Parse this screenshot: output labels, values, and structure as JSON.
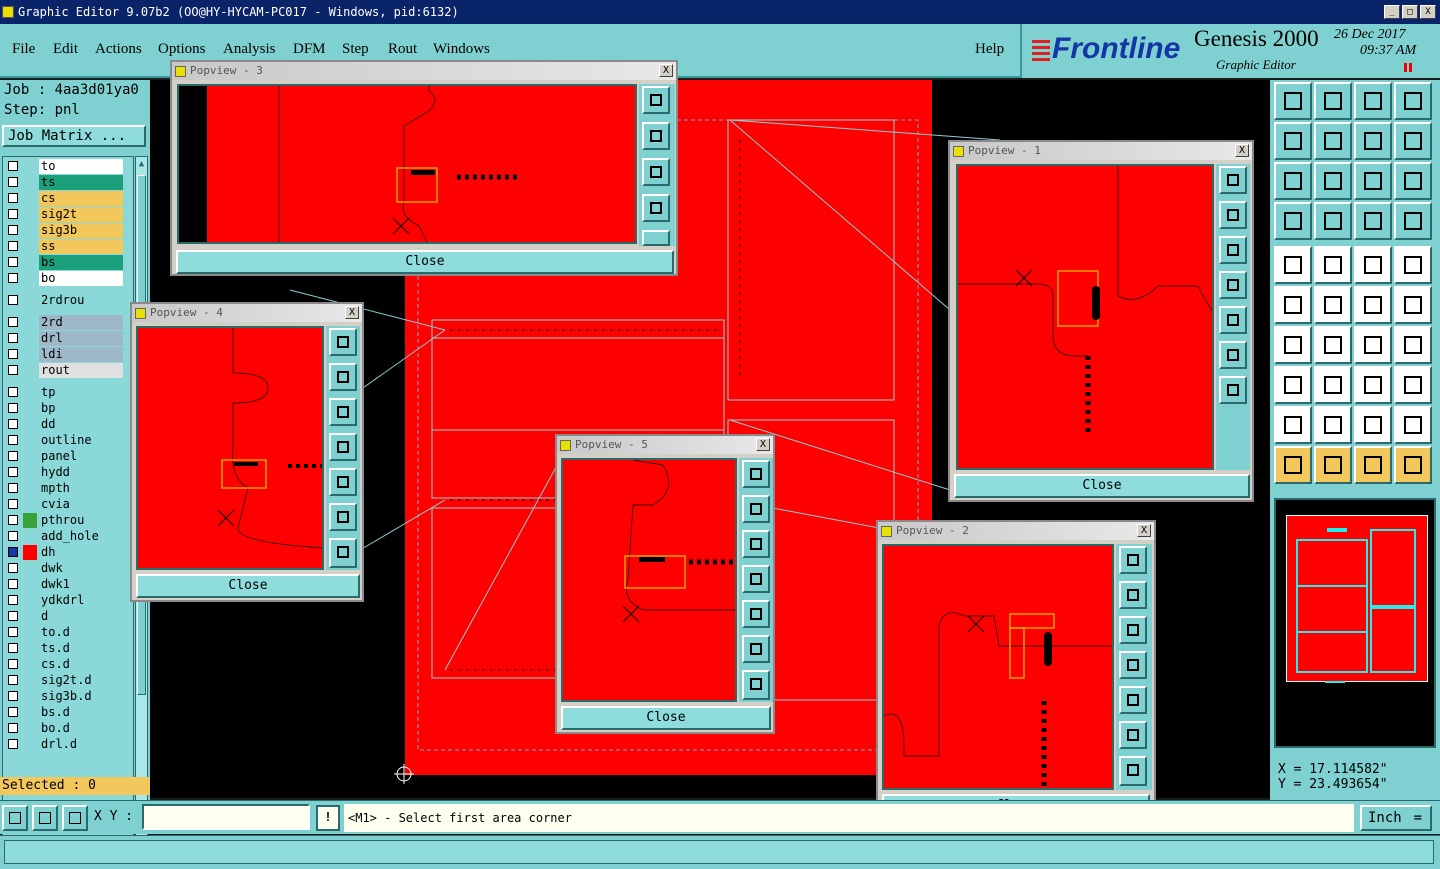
{
  "window": {
    "title": "Graphic Editor 9.07b2 (OO@HY-HYCAM-PC017 - Windows, pid:6132)",
    "btn_min": "_",
    "btn_max": "□",
    "btn_close": "X"
  },
  "menu": [
    "File",
    "Edit",
    "Actions",
    "Options",
    "Analysis",
    "DFM",
    "Step",
    "Rout",
    "Windows"
  ],
  "help": "Help",
  "brand": {
    "logo": "Frontline",
    "product": "Genesis 2000",
    "subtitle": "Graphic Editor",
    "date": "26 Dec 2017",
    "time": "09:37 AM"
  },
  "job": {
    "job_line": "Job : 4aa3d01ya0",
    "step_line": "Step: pnl",
    "job_matrix": "Job Matrix ..."
  },
  "layers": [
    {
      "name": "to",
      "color": "#ffffff"
    },
    {
      "name": "ts",
      "color": "#1aa07a"
    },
    {
      "name": "cs",
      "color": "#f2c75b"
    },
    {
      "name": "sig2t",
      "color": "#f2c75b"
    },
    {
      "name": "sig3b",
      "color": "#f2c75b"
    },
    {
      "name": "ss",
      "color": "#f2c75b"
    },
    {
      "name": "bs",
      "color": "#1aa07a"
    },
    {
      "name": "bo",
      "color": "#ffffff"
    },
    {
      "name": "2rdrou",
      "color": "#8ad8d8"
    },
    {
      "name": "2rd",
      "color": "#9fb8c8"
    },
    {
      "name": "drl",
      "color": "#9fb8c8"
    },
    {
      "name": "ldi",
      "color": "#9fb8c8"
    },
    {
      "name": "rout",
      "color": "#e0e0e0"
    },
    {
      "name": "tp",
      "color": "#8ad8d8"
    },
    {
      "name": "bp",
      "color": "#8ad8d8"
    },
    {
      "name": "dd",
      "color": "#8ad8d8"
    },
    {
      "name": "outline",
      "color": "#8ad8d8"
    },
    {
      "name": "panel",
      "color": "#8ad8d8"
    },
    {
      "name": "hydd",
      "color": "#8ad8d8"
    },
    {
      "name": "mpth",
      "color": "#8ad8d8"
    },
    {
      "name": "cvia",
      "color": "#8ad8d8"
    },
    {
      "name": "pthrou",
      "color": "#8ad8d8"
    },
    {
      "name": "add_hole",
      "color": "#8ad8d8"
    },
    {
      "name": "dh",
      "color": "#8ad8d8"
    },
    {
      "name": "dwk",
      "color": "#8ad8d8"
    },
    {
      "name": "dwk1",
      "color": "#8ad8d8"
    },
    {
      "name": "ydkdrl",
      "color": "#8ad8d8"
    },
    {
      "name": "d",
      "color": "#8ad8d8"
    },
    {
      "name": "to.d",
      "color": "#8ad8d8"
    },
    {
      "name": "ts.d",
      "color": "#8ad8d8"
    },
    {
      "name": "cs.d",
      "color": "#8ad8d8"
    },
    {
      "name": "sig2t.d",
      "color": "#8ad8d8"
    },
    {
      "name": "sig3b.d",
      "color": "#8ad8d8"
    },
    {
      "name": "bs.d",
      "color": "#8ad8d8"
    },
    {
      "name": "bo.d",
      "color": "#8ad8d8"
    },
    {
      "name": "drl.d",
      "color": "#8ad8d8"
    }
  ],
  "selected": "Selected : 0",
  "popups": [
    {
      "title": "Popview - 3",
      "close": "Close"
    },
    {
      "title": "Popview - 1",
      "close": "Close"
    },
    {
      "title": "Popview - 4",
      "close": "Close"
    },
    {
      "title": "Popview - 5",
      "close": "Close"
    },
    {
      "title": "Popview - 2",
      "close": "Close"
    }
  ],
  "popup_x": "X",
  "coords": {
    "x": "X = 17.114582\"",
    "y": "Y = 23.493654\""
  },
  "bottom": {
    "xy_label": "X Y :",
    "xy_value": "",
    "warn": "!",
    "prompt": "<M1> - Select first area corner",
    "units": "Inch",
    "units_arrow": "="
  }
}
